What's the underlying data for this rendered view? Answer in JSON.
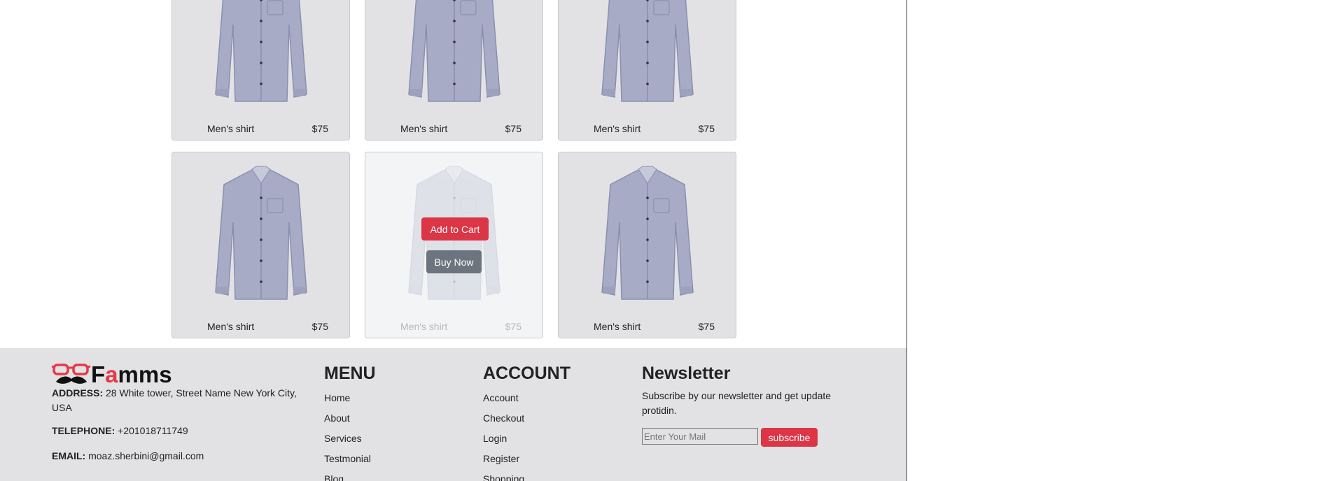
{
  "products": [
    {
      "name": "Men's shirt",
      "price": "$75"
    },
    {
      "name": "Men's shirt",
      "price": "$75"
    },
    {
      "name": "Men's shirt",
      "price": "$75"
    },
    {
      "name": "Men's shirt",
      "price": "$75"
    },
    {
      "name": "Men's shirt",
      "price": "$75"
    },
    {
      "name": "Men's shirt",
      "price": "$75"
    }
  ],
  "hover_actions": {
    "add_to_cart": "Add to Cart",
    "buy_now": "Buy Now"
  },
  "footer": {
    "brand": {
      "first": "F",
      "accent": "a",
      "rest": "mms"
    },
    "address_label": "ADDRESS:",
    "address": "28 White tower, Street Name New York City, USA",
    "telephone_label": "TELEPHONE:",
    "telephone": "+201018711749",
    "email_label": "EMAIL:",
    "email": "moaz.sherbini@gmail.com",
    "menu": {
      "title": "MENU",
      "items": [
        "Home",
        "About",
        "Services",
        "Testmonial",
        "Blog"
      ]
    },
    "account": {
      "title": "ACCOUNT",
      "items": [
        "Account",
        "Checkout",
        "Login",
        "Register",
        "Shopping"
      ]
    },
    "newsletter": {
      "title": "Newsletter",
      "text": "Subscribe by our newsletter and get update protidin.",
      "placeholder": "Enter Your Mail",
      "button": "subscribe"
    }
  },
  "colors": {
    "accent": "#dc3545",
    "secondary": "#6c757d",
    "card_bg": "#e2e2e5"
  },
  "icons": {
    "logo": "glasses-mustache-icon",
    "product_image": "shirt-icon"
  }
}
